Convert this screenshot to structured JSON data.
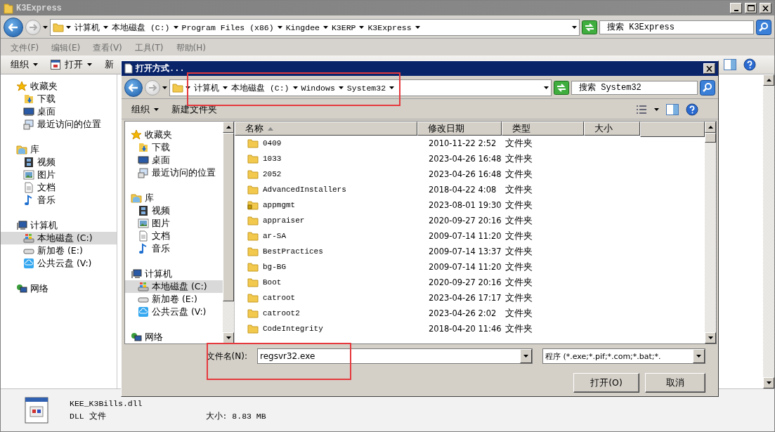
{
  "window": {
    "title": "K3Express"
  },
  "address_bar": {
    "crumbs": [
      "计算机",
      "本地磁盘 (C:)",
      "Program Files (x86)",
      "Kingdee",
      "K3ERP",
      "K3Express"
    ],
    "search_placeholder": "搜索 K3Express"
  },
  "menu": [
    "文件(F)",
    "编辑(E)",
    "查看(V)",
    "工具(T)",
    "帮助(H)"
  ],
  "toolbar": [
    {
      "label": "组织",
      "kind": "dropdown"
    },
    {
      "label": "打开",
      "kind": "open"
    },
    {
      "label": "新",
      "kind": "plain"
    }
  ],
  "nav": [
    {
      "label": "收藏夹",
      "kind": "star",
      "selected": false,
      "children": [
        {
          "label": "下载",
          "kind": "download",
          "selected": false
        },
        {
          "label": "桌面",
          "kind": "desktop",
          "selected": false
        },
        {
          "label": "最近访问的位置",
          "kind": "recent",
          "selected": false
        }
      ]
    },
    {
      "label": "库",
      "kind": "library",
      "selected": false,
      "children": [
        {
          "label": "视频",
          "kind": "video",
          "selected": false
        },
        {
          "label": "图片",
          "kind": "picture",
          "selected": false
        },
        {
          "label": "文档",
          "kind": "document",
          "selected": false
        },
        {
          "label": "音乐",
          "kind": "music",
          "selected": false
        }
      ]
    },
    {
      "label": "计算机",
      "kind": "computer",
      "selected": false,
      "children": [
        {
          "label": "本地磁盘 (C:)",
          "kind": "system-drive",
          "selected": true
        },
        {
          "label": "新加卷 (E:)",
          "kind": "drive",
          "selected": false
        },
        {
          "label": "公共云盘 (V:)",
          "kind": "cloud",
          "selected": false
        }
      ]
    },
    {
      "label": "网络",
      "kind": "network",
      "selected": false
    }
  ],
  "details": {
    "name": "KEE_K3Bills.dll",
    "type": "DLL 文件",
    "size": "大小: 8.83 MB"
  },
  "dialog": {
    "title": "打开方式...",
    "crumbs": [
      "计算机",
      "本地磁盘 (C:)",
      "Windows",
      "System32"
    ],
    "search_placeholder": "搜索 System32",
    "toolbar": [
      {
        "label": "组织",
        "kind": "dropdown"
      },
      {
        "label": "新建文件夹",
        "kind": "plain"
      }
    ],
    "nav": [
      {
        "label": "收藏夹",
        "kind": "star",
        "selected": false,
        "children": [
          {
            "label": "下载",
            "kind": "download",
            "selected": false
          },
          {
            "label": "桌面",
            "kind": "desktop",
            "selected": false
          },
          {
            "label": "最近访问的位置",
            "kind": "recent",
            "selected": false
          }
        ]
      },
      {
        "label": "库",
        "kind": "library",
        "selected": false,
        "children": [
          {
            "label": "视频",
            "kind": "video",
            "selected": false
          },
          {
            "label": "图片",
            "kind": "picture",
            "selected": false
          },
          {
            "label": "文档",
            "kind": "document",
            "selected": false
          },
          {
            "label": "音乐",
            "kind": "music",
            "selected": false
          }
        ]
      },
      {
        "label": "计算机",
        "kind": "computer",
        "selected": false,
        "children": [
          {
            "label": "本地磁盘 (C:)",
            "kind": "system-drive",
            "selected": true
          },
          {
            "label": "新加卷 (E:)",
            "kind": "drive",
            "selected": false
          },
          {
            "label": "公共云盘 (V:)",
            "kind": "cloud",
            "selected": false
          }
        ]
      },
      {
        "label": "网络",
        "kind": "network",
        "selected": false
      }
    ],
    "columns": [
      {
        "label": "名称",
        "sorted": true
      },
      {
        "label": "修改日期",
        "sorted": false
      },
      {
        "label": "类型",
        "sorted": false
      },
      {
        "label": "大小",
        "sorted": false
      }
    ],
    "rows": [
      {
        "name": "0409",
        "date": "2010-11-22 2:52",
        "type": "文件夹",
        "kind": "folder"
      },
      {
        "name": "1033",
        "date": "2023-04-26 16:48",
        "type": "文件夹",
        "kind": "folder"
      },
      {
        "name": "2052",
        "date": "2023-04-26 16:48",
        "type": "文件夹",
        "kind": "folder"
      },
      {
        "name": "AdvancedInstallers",
        "date": "2018-04-22 4:08",
        "type": "文件夹",
        "kind": "folder"
      },
      {
        "name": "appmgmt",
        "date": "2023-08-01 19:30",
        "type": "文件夹",
        "kind": "locked-folder"
      },
      {
        "name": "appraiser",
        "date": "2020-09-27 20:16",
        "type": "文件夹",
        "kind": "folder"
      },
      {
        "name": "ar-SA",
        "date": "2009-07-14 11:20",
        "type": "文件夹",
        "kind": "folder"
      },
      {
        "name": "BestPractices",
        "date": "2009-07-14 13:37",
        "type": "文件夹",
        "kind": "folder"
      },
      {
        "name": "bg-BG",
        "date": "2009-07-14 11:20",
        "type": "文件夹",
        "kind": "folder"
      },
      {
        "name": "Boot",
        "date": "2020-09-27 20:16",
        "type": "文件夹",
        "kind": "folder"
      },
      {
        "name": "catroot",
        "date": "2023-04-26 17:17",
        "type": "文件夹",
        "kind": "folder"
      },
      {
        "name": "catroot2",
        "date": "2023-04-26 2:02",
        "type": "文件夹",
        "kind": "folder"
      },
      {
        "name": "CodeIntegrity",
        "date": "2018-04-20 11:46",
        "type": "文件夹",
        "kind": "folder"
      }
    ],
    "filename_label": "文件名(N):",
    "filename": "regsvr32.exe",
    "filetype": "程序 (*.exe;*.pif;*.com;*.bat;*.",
    "buttons": [
      "打开(O)",
      "取消"
    ]
  }
}
